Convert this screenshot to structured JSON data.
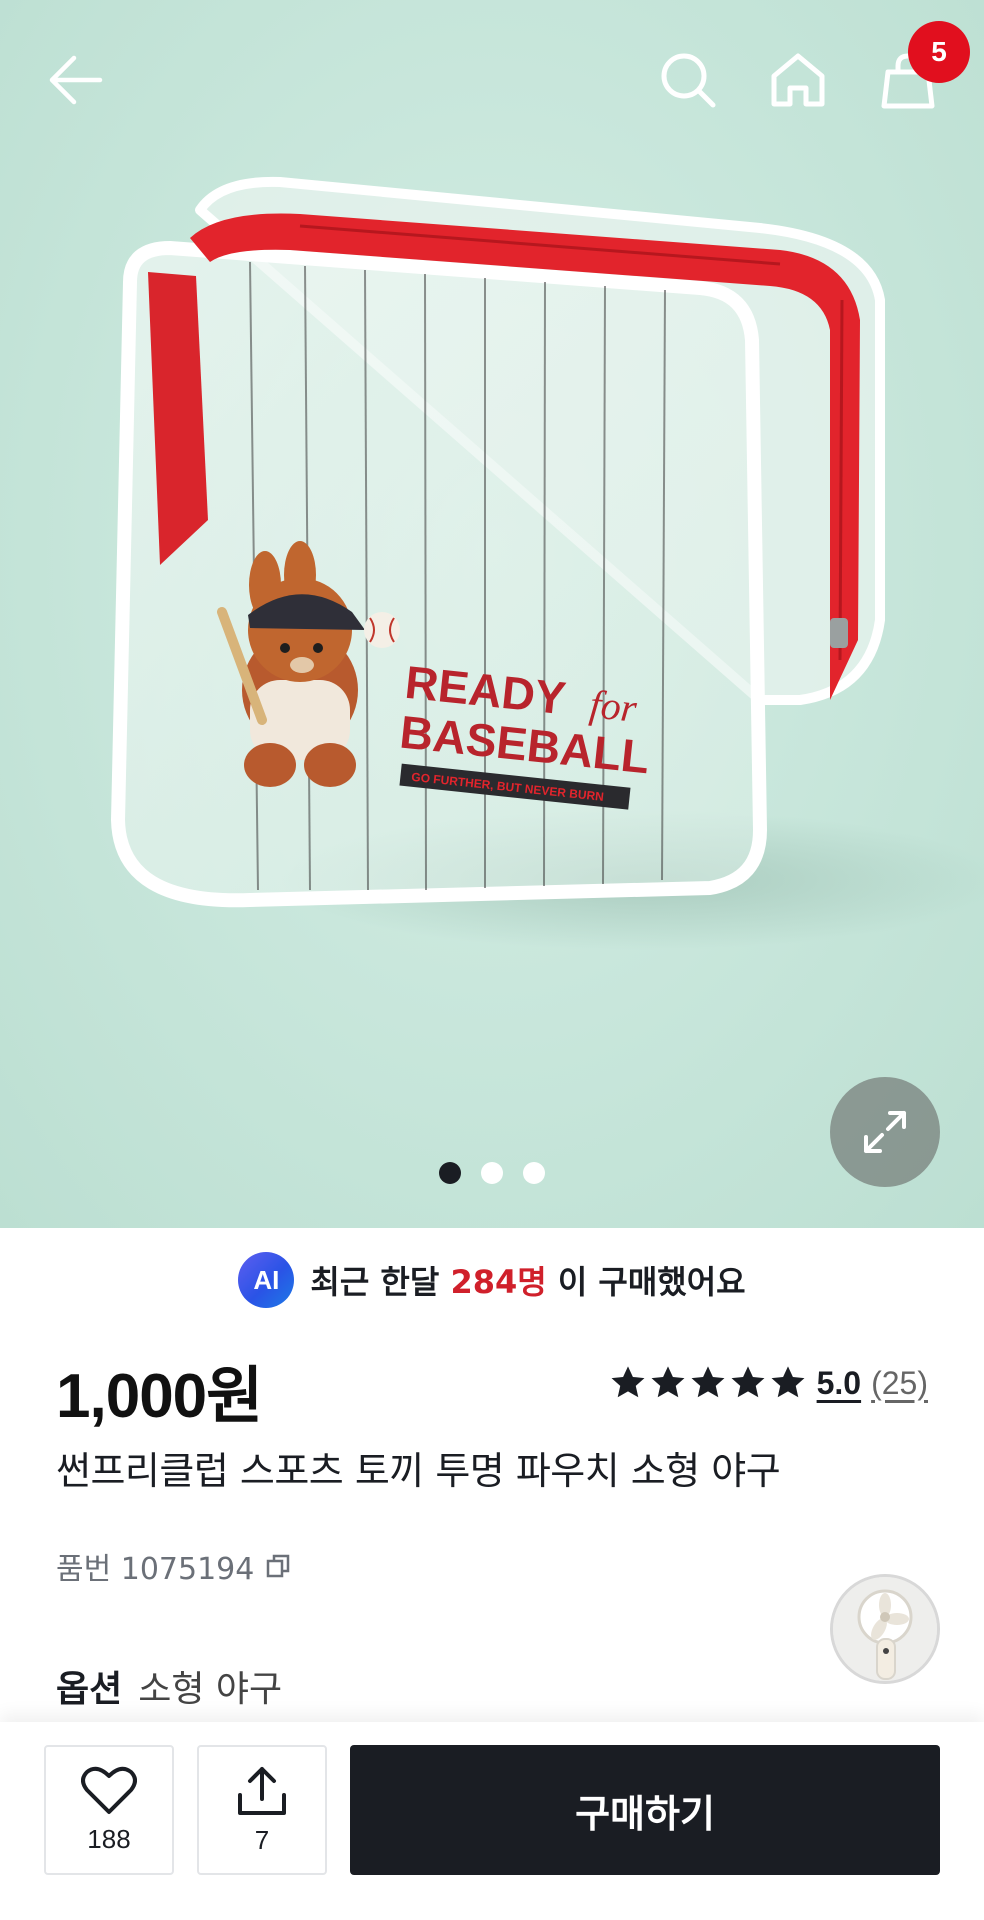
{
  "topbar": {
    "icons": [
      "back-arrow-icon",
      "search-icon",
      "home-icon",
      "shopping-bag-icon"
    ],
    "cart_badge": "5"
  },
  "hero": {
    "pouch_print_line1": "READY",
    "pouch_print_script": "for",
    "pouch_print_line2": "BASEBALL",
    "pouch_print_tagline": "GO FURTHER, BUT NEVER BURN",
    "slides_total": 3,
    "slide_active": 1,
    "expand_icon": "expand-icon"
  },
  "ai_banner": {
    "badge": "AI",
    "prefix": "최근 한달",
    "count": "284명",
    "suffix": "이 구매했어요"
  },
  "product": {
    "price": "1,000원",
    "rating_stars": 5,
    "rating_score": "5.0",
    "rating_count": "(25)",
    "title": "썬프리클럽 스포츠 토끼 투명 파우치 소형 야구",
    "sku_label": "품번 1075194",
    "copy_icon": "copy-icon",
    "option_label": "옵션",
    "option_value": "소형 야구"
  },
  "bottom_bar": {
    "like_count": "188",
    "share_count": "7",
    "buy_label": "구매하기"
  },
  "colors": {
    "accent_red": "#d0202b",
    "badge_red": "#e10f1e",
    "dark": "#1a1d23",
    "hero_bg": "#c9e7dc"
  }
}
